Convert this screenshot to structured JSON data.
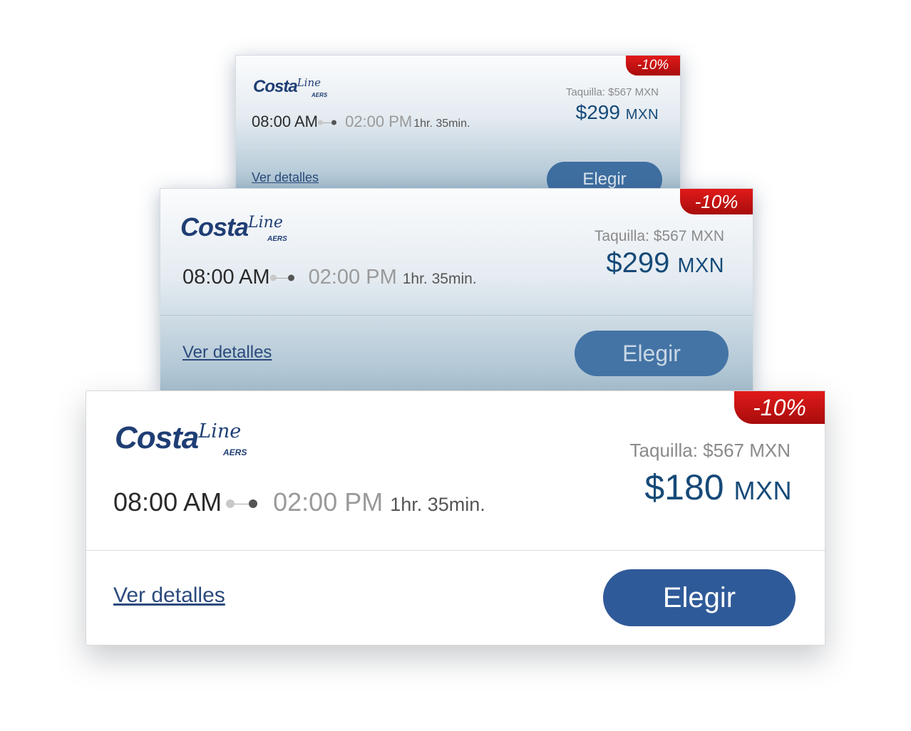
{
  "colors": {
    "brand_blue": "#1f3e74",
    "button_blue": "#2f5a99",
    "badge_red": "#c91212",
    "price_blue": "#164a78"
  },
  "cards": [
    {
      "brand": {
        "main": "Costa",
        "script": "Line",
        "sub": "AERS"
      },
      "discount": "-10%",
      "departure": "08:00 AM",
      "arrival": "02:00 PM",
      "duration": "1hr. 35min.",
      "taquilla": "Taquilla: $567 MXN",
      "price": "$299",
      "currency": "MXN",
      "details": "Ver detalles",
      "choose": "Elegir"
    },
    {
      "brand": {
        "main": "Costa",
        "script": "Line",
        "sub": "AERS"
      },
      "discount": "-10%",
      "departure": "08:00 AM",
      "arrival": "02:00 PM",
      "duration": "1hr. 35min.",
      "taquilla": "Taquilla: $567 MXN",
      "price": "$299",
      "currency": "MXN",
      "details": "Ver detalles",
      "choose": "Elegir"
    },
    {
      "brand": {
        "main": "Costa",
        "script": "Line",
        "sub": "AERS"
      },
      "discount": "-10%",
      "departure": "08:00 AM",
      "arrival": "02:00 PM",
      "duration": "1hr. 35min.",
      "taquilla": "Taquilla: $567 MXN",
      "price": "$180",
      "currency": "MXN",
      "details": "Ver detalles",
      "choose": "Elegir"
    }
  ]
}
